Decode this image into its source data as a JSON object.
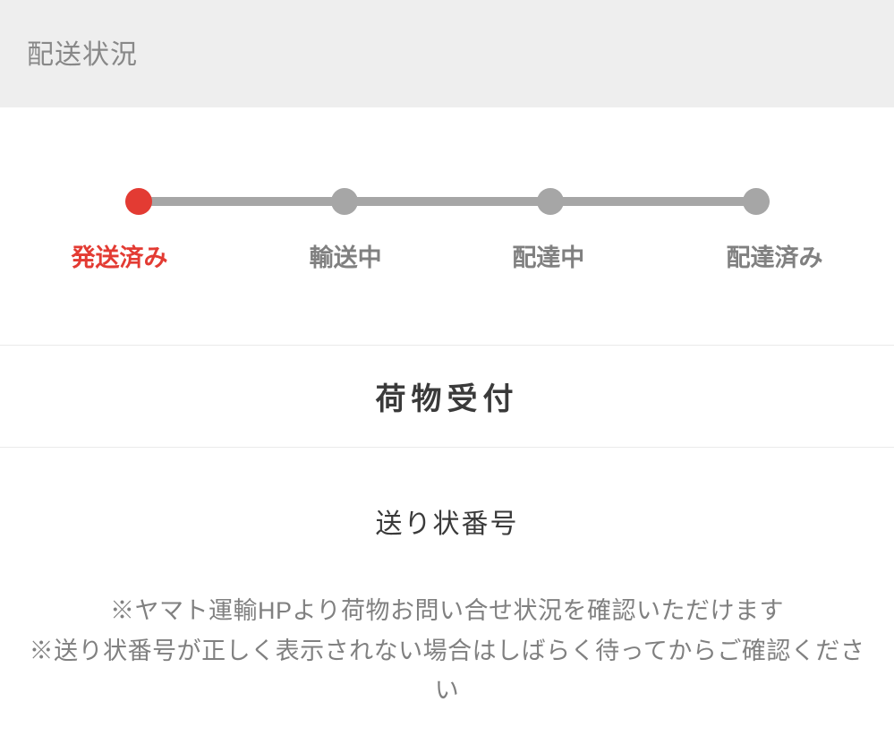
{
  "header": {
    "title": "配送状況"
  },
  "progress": {
    "steps": [
      {
        "label": "発送済み",
        "active": true
      },
      {
        "label": "輸送中",
        "active": false
      },
      {
        "label": "配達中",
        "active": false
      },
      {
        "label": "配達済み",
        "active": false
      }
    ]
  },
  "status": {
    "title": "荷物受付"
  },
  "tracking": {
    "label": "送り状番号",
    "note1": "※ヤマト運輸HPより荷物お問い合せ状況を確認いただけます",
    "note2": "※送り状番号が正しく表示されない場合はしばらく待ってからご確認ください"
  },
  "colors": {
    "accent": "#e33b33",
    "muted": "#a6a6a6"
  }
}
